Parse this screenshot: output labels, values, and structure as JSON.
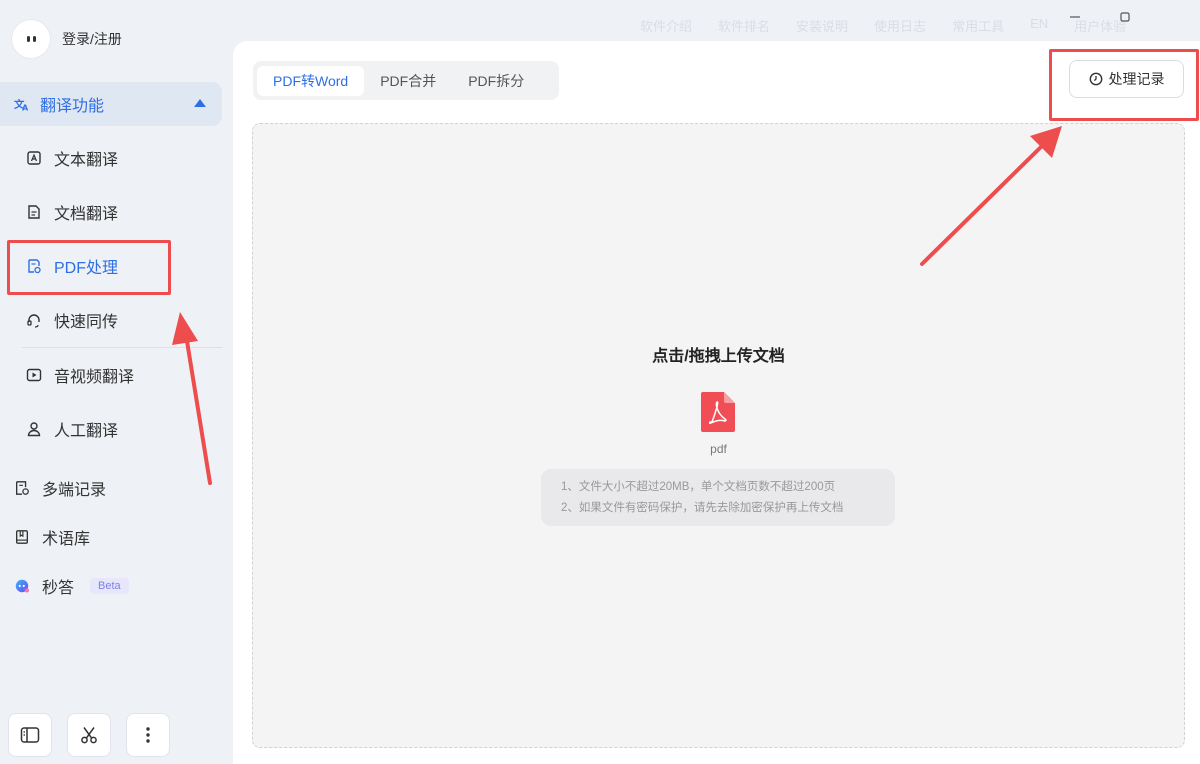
{
  "background_nav": [
    "软件介绍",
    "软件排名",
    "安装说明",
    "使用日志",
    "常用工具",
    "EN",
    "用户体验"
  ],
  "window": {
    "minimize_icon": "minus",
    "maximize_icon": "square"
  },
  "user": {
    "login_label": "登录/注册"
  },
  "sidebar": {
    "group_label": "翻译功能",
    "sub_items": [
      {
        "label": "文本翻译",
        "icon": "text-icon"
      },
      {
        "label": "文档翻译",
        "icon": "document-icon"
      },
      {
        "label": "PDF处理",
        "icon": "pdf-icon"
      },
      {
        "label": "快速同传",
        "icon": "headset-icon"
      },
      {
        "label": "音视频翻译",
        "icon": "video-icon"
      },
      {
        "label": "人工翻译",
        "icon": "person-icon"
      }
    ],
    "main_items": [
      {
        "label": "多端记录",
        "icon": "records-icon"
      },
      {
        "label": "术语库",
        "icon": "book-icon"
      },
      {
        "label": "秒答",
        "icon": "ai-icon",
        "badge": "Beta"
      }
    ]
  },
  "tabs": [
    {
      "label": "PDF转Word",
      "active": true
    },
    {
      "label": "PDF合并",
      "active": false
    },
    {
      "label": "PDF拆分",
      "active": false
    }
  ],
  "history_button": {
    "label": "处理记录"
  },
  "upload": {
    "title": "点击/拖拽上传文档",
    "file_type": "pdf",
    "notes": [
      "1、文件大小不超过20MB，单个文档页数不超过200页",
      "2、如果文件有密码保护，请先去除加密保护再上传文档"
    ]
  },
  "colors": {
    "accent": "#2f6fe4",
    "highlight": "#ee4d4d",
    "pdf_red": "#f04e54"
  }
}
